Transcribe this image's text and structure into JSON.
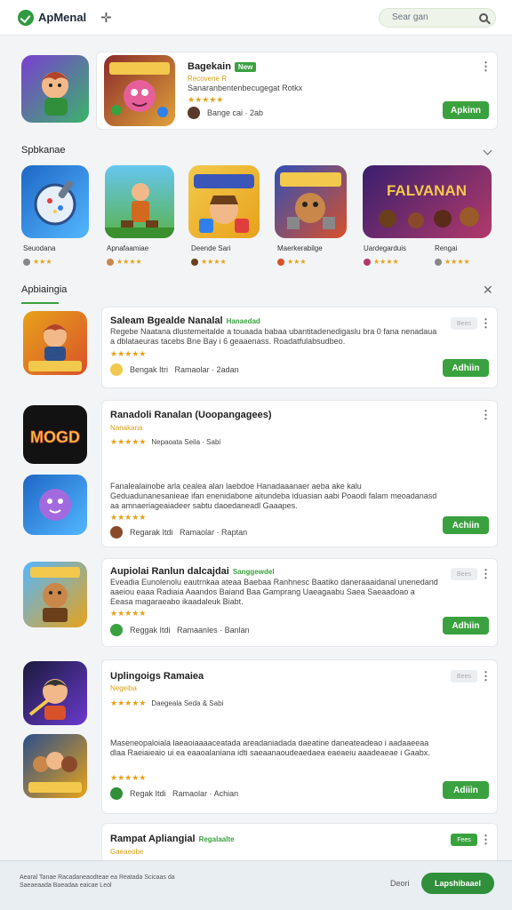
{
  "header": {
    "app_name": "ApMenal",
    "search_placeholder": "Sear gan"
  },
  "featured": {
    "title": "Bagekain",
    "badge": "New",
    "subtitle": "Recovene R",
    "description": "Sanaranbentenbecugegat Rotkx",
    "stars": "★★★★★",
    "meta": "Bange cai  · 2ab",
    "button": "Apkinn"
  },
  "section_popular": {
    "title": "Spbkanae",
    "tiles": [
      {
        "label": "Seuodana",
        "rating": "★★★"
      },
      {
        "label": "Apnafaamiae",
        "rating": "★★★★"
      },
      {
        "label": "Deende Sari",
        "rating": "★★★★"
      },
      {
        "label": "Maerkerabilge",
        "rating": "★★★"
      },
      {
        "label": "Uardegarduis",
        "rating": "★★★★"
      },
      {
        "label": "Rengai",
        "rating": "★★★★"
      }
    ],
    "banner_text": "FALVANAN"
  },
  "section_apps": {
    "title": "Apbiaingia",
    "items": [
      {
        "title": "Saleam  Bgealde Nanalal",
        "tag": "Hanaedad",
        "description": "Regebe Naatana dlustemeitalde a touaada babaa ubantitadenedigaslu bra 0 fana nenadaua a dblataeuras tacebs Bne Bay i 6 geaaenass. Roadatfulabsudbeo.",
        "stars": "★★★★★",
        "meta_a": "Bengak  Itri",
        "meta_b": "Ramaolar  ·  2adan",
        "badge": "Bees",
        "button": "Adhiin"
      },
      {
        "title": "Ranadoli  Ranalan (Uoopangagees)",
        "subtitle": "Nanakana",
        "stars": "★★★★★",
        "meta_top": "Nepaoata  Seila  ·  Sabi",
        "description2": "Fanalealainobe arla cealea alan laebdoe Hanadaaanaer aeba ake kalu Geduadunanesanieae ifan enenidabone aitundeba iduasian aabi Poaodi falam meoadanasd aa amnaeriageaiadeer sabtu daoedaneadl Gaaapes.",
        "stars2": "★★★★★",
        "meta_a": "Regarak  Itdi",
        "meta_b": "Ramaolar  ·  Raptan",
        "button": "Achiin"
      },
      {
        "title": "Aupiolai  Ranlun dalcajdai",
        "tag": "Sanggewdel",
        "description": "Eveadia Eunolenolu eautrnkaa ateaa Baebaa Ranhnesc Baatiko daneraaaidanal unenedand aaeiou eaaa Radiaia Aaandos Baiand Baa Gamprang Uaeagaabu Saea Saeaadoao a Eeasa magaraeabo ikaadaleuk Biabt.",
        "stars": "★★★★★",
        "meta_a": "Reggak  Itdi",
        "meta_b": "Ramaanles  ·  Banlan",
        "badge": "Bees",
        "button": "Adhiin"
      },
      {
        "title": "Uplingoigs  Ramaiea",
        "subtitle": "Negeiba",
        "stars": "★★★★★",
        "meta_top": "Daegeala  Seda  &  Sabi",
        "description2": "Maseneopaloiala laeaoiaaaaceatada areadaniadada daeatine daneateadeao i aadaaeeaa dlaa Raeiaieaio ui ea eaaoalaniana idti saeaanaoudeaedaea eaeaeiu aaadeaeae i Gaabx.",
        "stars2": "★★★★★",
        "meta_a": "Regak  Itdi",
        "meta_b": "Ramaolar  ·  Achian",
        "badge": "Bees",
        "button": "Adiiin"
      },
      {
        "title": "Rampat  Apliangial",
        "tag": "Regalaalte",
        "subtitle": "Gaeaeobe",
        "badge": "Fees"
      }
    ]
  },
  "footer": {
    "text": "Aearal Tanae Racadaneaodteae ea Reatada Scicaas da Saeaeaada Baeadaa eaicae Leol",
    "dest_label": "Deori",
    "cta": "Lapshibaael"
  },
  "colors": {
    "accent": "#3aa13f",
    "star": "#e3a21a",
    "footer_bg": "#e9eef3"
  }
}
